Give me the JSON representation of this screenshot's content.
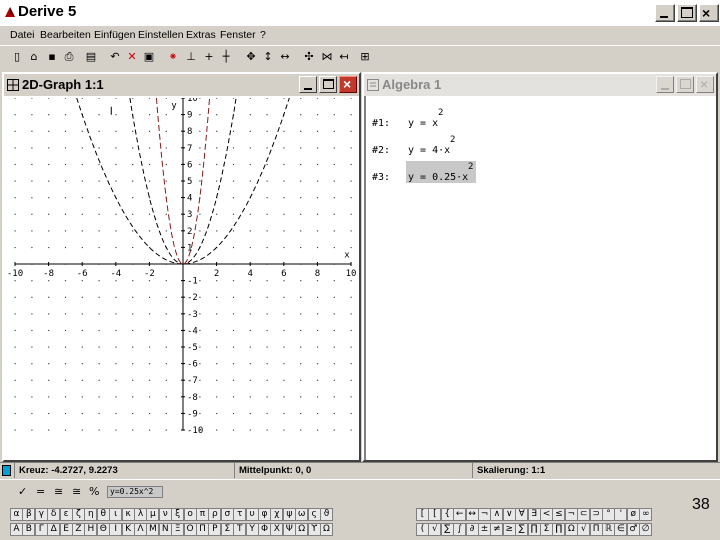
{
  "app": {
    "title": "Derive 5"
  },
  "menu": [
    "Datei",
    "Bearbeiten",
    "Einfügen",
    "Einstellen",
    "Extras",
    "Fenster",
    "?"
  ],
  "graph_window": {
    "title": "2D-Graph 1:1",
    "axis_labels": {
      "x": "x",
      "y": "y"
    },
    "x_ticks": [
      "-10",
      "-8",
      "-6",
      "-4",
      "-2",
      "2",
      "4",
      "6",
      "8",
      "10"
    ],
    "y_ticks": [
      "10",
      "9",
      "8",
      "7",
      "6",
      "5",
      "4",
      "3",
      "2",
      "1",
      "-1",
      "-2",
      "-3",
      "-4",
      "-5",
      "-6",
      "-7",
      "-8",
      "-9",
      "-10"
    ],
    "curve_colors": {
      "black": "#000000",
      "darkred": "#8b1a1a"
    }
  },
  "algebra_window": {
    "title": "Algebra 1",
    "expressions": [
      {
        "label": "#1:",
        "body": "y = x",
        "exponent": "2",
        "selected": false
      },
      {
        "label": "#2:",
        "body": "y = 4·x",
        "exponent": "2",
        "selected": false
      },
      {
        "label": "#3:",
        "body": "y = 0.25·x",
        "exponent": "2",
        "selected": true
      }
    ]
  },
  "statusbar": {
    "cross": "Kreuz: -4.2727, 9.2273",
    "center": "Mittelpunkt: 0, 0",
    "scale": "Skalierung: 1:1"
  },
  "entry": {
    "value": "y=0.25x^2"
  },
  "page_number": "38",
  "greek_palette": {
    "row1": [
      "α",
      "β",
      "γ",
      "δ",
      "ε",
      "ζ",
      "η",
      "θ",
      "ι",
      "κ",
      "λ",
      "μ",
      "ν",
      "ξ",
      "ο",
      "π",
      "ρ",
      "σ",
      "τ",
      "υ",
      "φ",
      "χ",
      "ψ",
      "ω",
      "ς",
      "ϑ"
    ],
    "row2": [
      "Α",
      "Β",
      "Γ",
      "Δ",
      "Ε",
      "Ζ",
      "Η",
      "Θ",
      "Ι",
      "Κ",
      "Λ",
      "Μ",
      "Ν",
      "Ξ",
      "Ο",
      "Π",
      "Ρ",
      "Σ",
      "Τ",
      "Υ",
      "Φ",
      "Χ",
      "Ψ",
      "Ω",
      "ϒ",
      "Ω"
    ]
  },
  "math_palette": {
    "row1": [
      "[",
      "[",
      "{",
      "←",
      "↔",
      "¬",
      "∧",
      "∨",
      "∀",
      "∃",
      "<",
      "≤",
      "¬",
      "⊂",
      "⊃",
      "°",
      "'",
      "ø",
      "∞"
    ],
    "row2": [
      "(",
      "√",
      "∑",
      "∫",
      "∂",
      "±",
      "≠",
      "≥",
      "∑",
      "∏",
      "Σ",
      "∏",
      "Ω",
      "√",
      "Π",
      "ℝ",
      "∈",
      "♂",
      "∅"
    ]
  }
}
